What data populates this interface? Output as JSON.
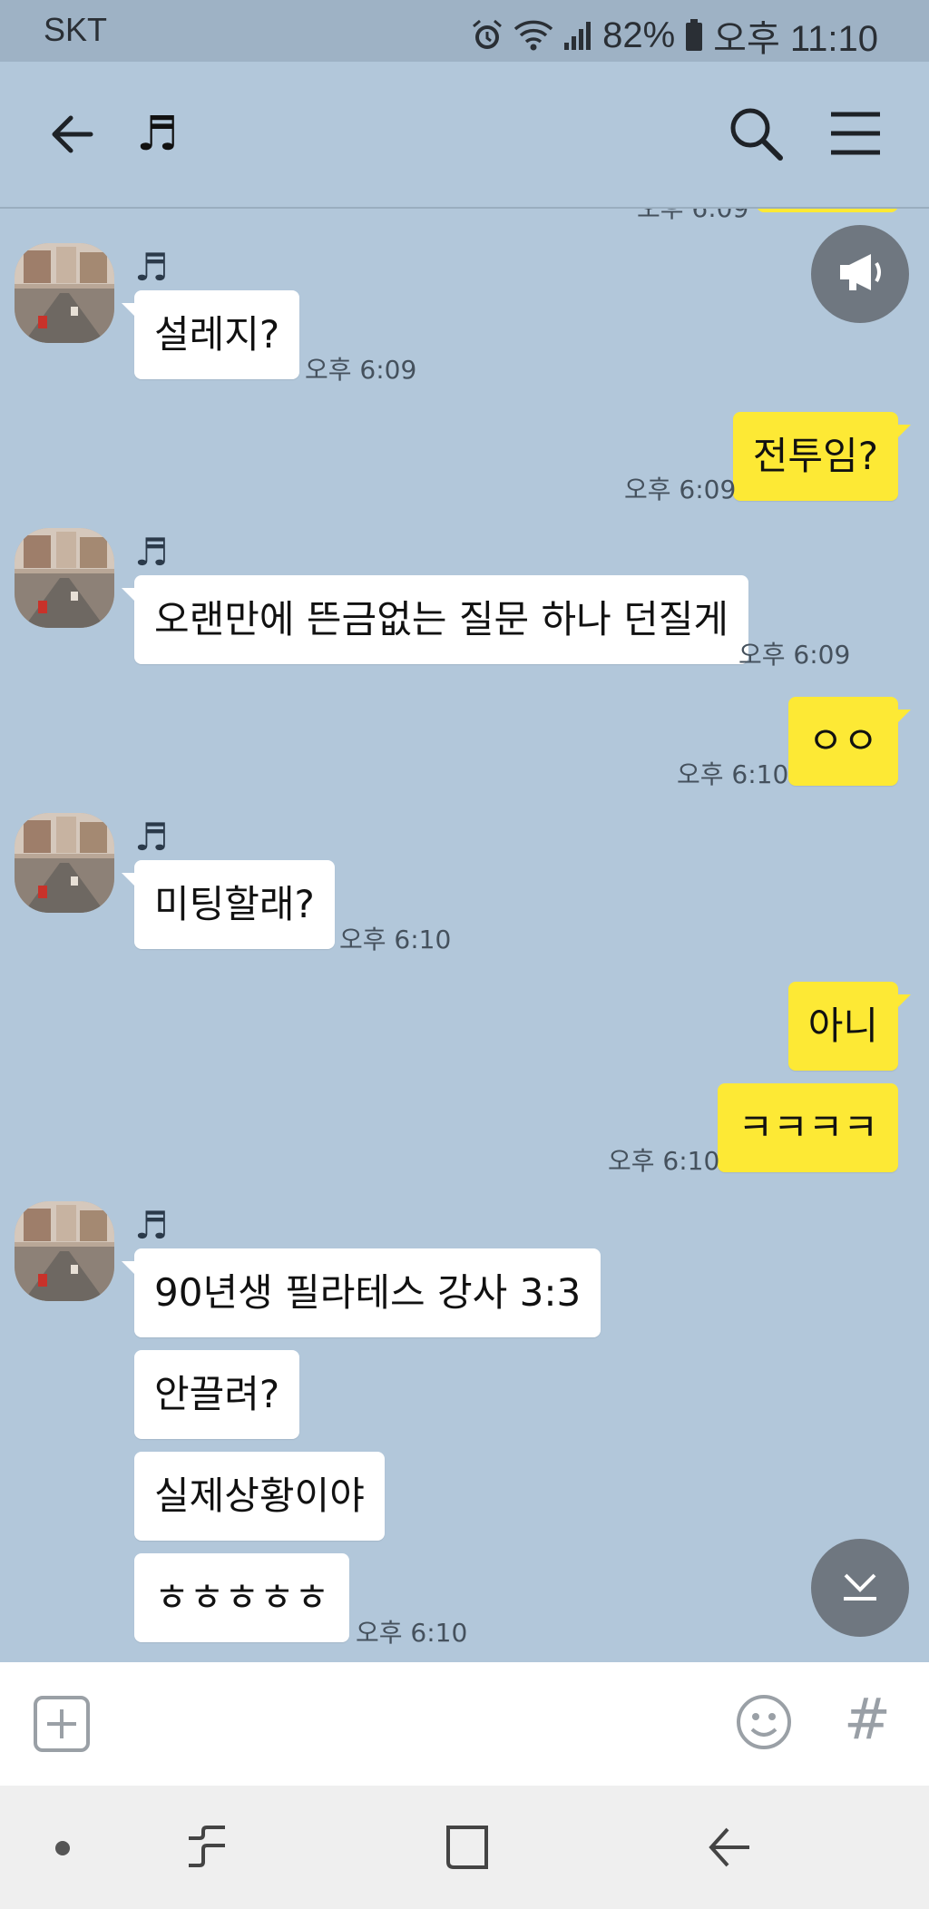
{
  "status_bar": {
    "carrier": "SKT",
    "battery": "82%",
    "time": "오후 11:10",
    "icons": [
      "alarm-icon",
      "wifi-icon",
      "signal-icon",
      "battery-icon"
    ]
  },
  "header": {
    "title_icon": "music-note-icon",
    "title": "♬",
    "icons": [
      "back-arrow-icon",
      "search-icon",
      "menu-icon"
    ]
  },
  "chat": {
    "partial_top_time": "오후 6:09",
    "messages": [
      {
        "side": "in",
        "sender": "♬",
        "text": "설레지?",
        "time": "오후 6:09"
      },
      {
        "side": "out",
        "text": "전투임?",
        "time": "오후 6:09"
      },
      {
        "side": "in",
        "sender": "♬",
        "text": "오랜만에 뜬금없는 질문 하나 던질게",
        "time": "오후 6:09"
      },
      {
        "side": "out",
        "text": "ㅇㅇ",
        "time": "오후 6:10"
      },
      {
        "side": "in",
        "sender": "♬",
        "text": "미팅할래?",
        "time": "오후 6:10"
      },
      {
        "side": "out",
        "text": "아니",
        "time": ""
      },
      {
        "side": "out",
        "text": "ㅋㅋㅋㅋ",
        "time": "오후 6:10"
      },
      {
        "side": "in",
        "sender": "♬",
        "text": "90년생 필라테스 강사 3:3",
        "time": ""
      },
      {
        "side": "in",
        "text": "안끌려?",
        "time": ""
      },
      {
        "side": "in",
        "text": "실제상황이야",
        "time": ""
      },
      {
        "side": "in",
        "text": "ㅎㅎㅎㅎㅎ",
        "time": "오후 6:10"
      }
    ],
    "floating_buttons": [
      "megaphone-icon",
      "scroll-down-icon"
    ]
  },
  "input_bar": {
    "icons": [
      "plus-icon",
      "emoji-icon"
    ],
    "hash": "#"
  },
  "nav_bar": {
    "icons": [
      "dot-icon",
      "recent-apps-icon",
      "home-icon",
      "back-nav-icon"
    ]
  },
  "colors": {
    "background": "#b2c7da",
    "outgoing_bubble": "#fde935",
    "incoming_bubble": "#ffffff",
    "fab": "#6f7780"
  }
}
